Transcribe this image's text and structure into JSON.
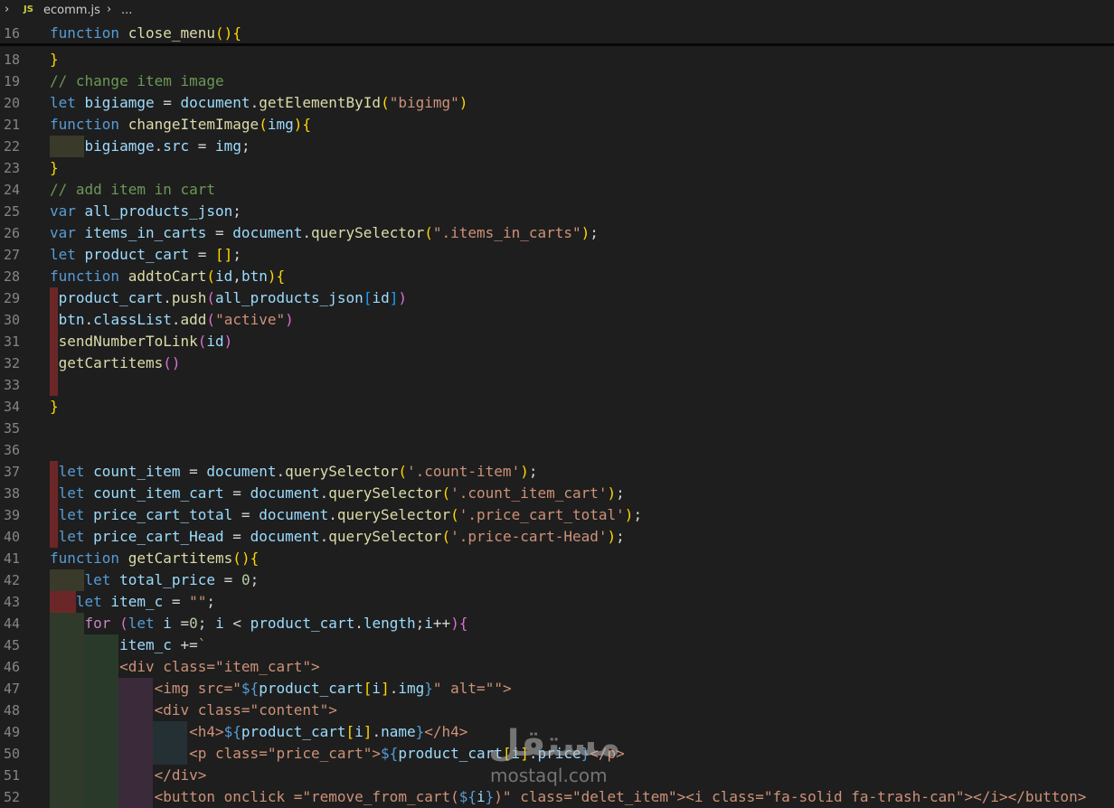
{
  "breadcrumb": {
    "file": "ecomm.js",
    "lang_badge": "JS",
    "trail": "..."
  },
  "sticky": {
    "line_number": "16",
    "tokens": [
      {
        "t": "function",
        "c": "k"
      },
      {
        "t": " close_menu",
        "c": "f"
      },
      {
        "t": "(",
        "c": "y"
      },
      {
        "t": ")",
        "c": "y"
      },
      {
        "t": "{",
        "c": "y"
      }
    ]
  },
  "lines": [
    {
      "n": "18",
      "tokens": [
        {
          "t": "}",
          "c": "y"
        }
      ]
    },
    {
      "n": "19",
      "tokens": [
        {
          "t": "// change item image",
          "c": "c"
        }
      ]
    },
    {
      "n": "20",
      "tokens": [
        {
          "t": "let",
          "c": "k"
        },
        {
          "t": " bigiamge ",
          "c": "v"
        },
        {
          "t": "= ",
          "c": "o"
        },
        {
          "t": "document",
          "c": "v"
        },
        {
          "t": ".",
          "c": "o"
        },
        {
          "t": "getElementById",
          "c": "f"
        },
        {
          "t": "(",
          "c": "y"
        },
        {
          "t": "\"bigimg\"",
          "c": "s"
        },
        {
          "t": ")",
          "c": "y"
        }
      ]
    },
    {
      "n": "21",
      "tokens": [
        {
          "t": "function",
          "c": "k"
        },
        {
          "t": " changeItemImage",
          "c": "f"
        },
        {
          "t": "(",
          "c": "y"
        },
        {
          "t": "img",
          "c": "v"
        },
        {
          "t": ")",
          "c": "y"
        },
        {
          "t": "{",
          "c": "y"
        }
      ]
    },
    {
      "n": "22",
      "tokens": [
        {
          "t": "    bigiamge",
          "c": "v"
        },
        {
          "t": ".",
          "c": "o"
        },
        {
          "t": "src",
          "c": "v"
        },
        {
          "t": " = ",
          "c": "o"
        },
        {
          "t": "img",
          "c": "v"
        },
        {
          "t": ";",
          "c": "o"
        }
      ]
    },
    {
      "n": "23",
      "tokens": [
        {
          "t": "}",
          "c": "y"
        }
      ]
    },
    {
      "n": "24",
      "tokens": [
        {
          "t": "// add item in cart",
          "c": "c"
        }
      ]
    },
    {
      "n": "25",
      "tokens": [
        {
          "t": "var",
          "c": "k"
        },
        {
          "t": " all_products_json",
          "c": "v"
        },
        {
          "t": ";",
          "c": "o"
        }
      ]
    },
    {
      "n": "26",
      "tokens": [
        {
          "t": "var",
          "c": "k"
        },
        {
          "t": " items_in_carts ",
          "c": "v"
        },
        {
          "t": "= ",
          "c": "o"
        },
        {
          "t": "document",
          "c": "v"
        },
        {
          "t": ".",
          "c": "o"
        },
        {
          "t": "querySelector",
          "c": "f"
        },
        {
          "t": "(",
          "c": "y"
        },
        {
          "t": "\".items_in_carts\"",
          "c": "s"
        },
        {
          "t": ")",
          "c": "y"
        },
        {
          "t": ";",
          "c": "o"
        }
      ]
    },
    {
      "n": "27",
      "tokens": [
        {
          "t": "let",
          "c": "k"
        },
        {
          "t": " product_cart ",
          "c": "v"
        },
        {
          "t": "= ",
          "c": "o"
        },
        {
          "t": "[",
          "c": "y"
        },
        {
          "t": "]",
          "c": "y"
        },
        {
          "t": ";",
          "c": "o"
        }
      ]
    },
    {
      "n": "28",
      "tokens": [
        {
          "t": "function",
          "c": "k"
        },
        {
          "t": " addtoCart",
          "c": "f"
        },
        {
          "t": "(",
          "c": "y"
        },
        {
          "t": "id",
          "c": "v"
        },
        {
          "t": ",",
          "c": "o"
        },
        {
          "t": "btn",
          "c": "v"
        },
        {
          "t": ")",
          "c": "y"
        },
        {
          "t": "{",
          "c": "y"
        }
      ]
    },
    {
      "n": "29",
      "tokens": [
        {
          "t": " product_cart",
          "c": "v"
        },
        {
          "t": ".",
          "c": "o"
        },
        {
          "t": "push",
          "c": "f"
        },
        {
          "t": "(",
          "c": "p"
        },
        {
          "t": "all_products_json",
          "c": "v"
        },
        {
          "t": "[",
          "c": "b"
        },
        {
          "t": "id",
          "c": "v"
        },
        {
          "t": "]",
          "c": "b"
        },
        {
          "t": ")",
          "c": "p"
        }
      ]
    },
    {
      "n": "30",
      "tokens": [
        {
          "t": " btn",
          "c": "v"
        },
        {
          "t": ".",
          "c": "o"
        },
        {
          "t": "classList",
          "c": "v"
        },
        {
          "t": ".",
          "c": "o"
        },
        {
          "t": "add",
          "c": "f"
        },
        {
          "t": "(",
          "c": "p"
        },
        {
          "t": "\"active\"",
          "c": "s"
        },
        {
          "t": ")",
          "c": "p"
        }
      ]
    },
    {
      "n": "31",
      "tokens": [
        {
          "t": " sendNumberToLink",
          "c": "f"
        },
        {
          "t": "(",
          "c": "p"
        },
        {
          "t": "id",
          "c": "v"
        },
        {
          "t": ")",
          "c": "p"
        }
      ]
    },
    {
      "n": "32",
      "tokens": [
        {
          "t": " getCartitems",
          "c": "f"
        },
        {
          "t": "(",
          "c": "p"
        },
        {
          "t": ")",
          "c": "p"
        }
      ]
    },
    {
      "n": "33",
      "tokens": []
    },
    {
      "n": "34",
      "tokens": [
        {
          "t": "}",
          "c": "y"
        }
      ]
    },
    {
      "n": "35",
      "tokens": []
    },
    {
      "n": "36",
      "tokens": []
    },
    {
      "n": "37",
      "tokens": [
        {
          "t": " let",
          "c": "k"
        },
        {
          "t": " count_item ",
          "c": "v"
        },
        {
          "t": "= ",
          "c": "o"
        },
        {
          "t": "document",
          "c": "v"
        },
        {
          "t": ".",
          "c": "o"
        },
        {
          "t": "querySelector",
          "c": "f"
        },
        {
          "t": "(",
          "c": "y"
        },
        {
          "t": "'.count-item'",
          "c": "s"
        },
        {
          "t": ")",
          "c": "y"
        },
        {
          "t": ";",
          "c": "o"
        }
      ]
    },
    {
      "n": "38",
      "tokens": [
        {
          "t": " let",
          "c": "k"
        },
        {
          "t": " count_item_cart ",
          "c": "v"
        },
        {
          "t": "= ",
          "c": "o"
        },
        {
          "t": "document",
          "c": "v"
        },
        {
          "t": ".",
          "c": "o"
        },
        {
          "t": "querySelector",
          "c": "f"
        },
        {
          "t": "(",
          "c": "y"
        },
        {
          "t": "'.count_item_cart'",
          "c": "s"
        },
        {
          "t": ")",
          "c": "y"
        },
        {
          "t": ";",
          "c": "o"
        }
      ]
    },
    {
      "n": "39",
      "tokens": [
        {
          "t": " let",
          "c": "k"
        },
        {
          "t": " price_cart_total ",
          "c": "v"
        },
        {
          "t": "= ",
          "c": "o"
        },
        {
          "t": "document",
          "c": "v"
        },
        {
          "t": ".",
          "c": "o"
        },
        {
          "t": "querySelector",
          "c": "f"
        },
        {
          "t": "(",
          "c": "y"
        },
        {
          "t": "'.price_cart_total'",
          "c": "s"
        },
        {
          "t": ")",
          "c": "y"
        },
        {
          "t": ";",
          "c": "o"
        }
      ]
    },
    {
      "n": "40",
      "tokens": [
        {
          "t": " let",
          "c": "k"
        },
        {
          "t": " price_cart_Head ",
          "c": "v"
        },
        {
          "t": "= ",
          "c": "o"
        },
        {
          "t": "document",
          "c": "v"
        },
        {
          "t": ".",
          "c": "o"
        },
        {
          "t": "querySelector",
          "c": "f"
        },
        {
          "t": "(",
          "c": "y"
        },
        {
          "t": "'.price-cart-Head'",
          "c": "s"
        },
        {
          "t": ")",
          "c": "y"
        },
        {
          "t": ";",
          "c": "o"
        }
      ]
    },
    {
      "n": "41",
      "tokens": [
        {
          "t": "function",
          "c": "k"
        },
        {
          "t": " getCartitems",
          "c": "f"
        },
        {
          "t": "(",
          "c": "y"
        },
        {
          "t": ")",
          "c": "y"
        },
        {
          "t": "{",
          "c": "y"
        }
      ]
    },
    {
      "n": "42",
      "tokens": [
        {
          "t": "    let",
          "c": "k"
        },
        {
          "t": " total_price ",
          "c": "v"
        },
        {
          "t": "= ",
          "c": "o"
        },
        {
          "t": "0",
          "c": "n"
        },
        {
          "t": ";",
          "c": "o"
        }
      ]
    },
    {
      "n": "43",
      "tokens": [
        {
          "t": "   let",
          "c": "k"
        },
        {
          "t": " item_c ",
          "c": "v"
        },
        {
          "t": "= ",
          "c": "o"
        },
        {
          "t": "\"\"",
          "c": "s"
        },
        {
          "t": ";",
          "c": "o"
        }
      ]
    },
    {
      "n": "44",
      "tokens": [
        {
          "t": "    for",
          "c": "kw"
        },
        {
          "t": " (",
          "c": "p"
        },
        {
          "t": "let",
          "c": "k"
        },
        {
          "t": " i ",
          "c": "v"
        },
        {
          "t": "=",
          "c": "o"
        },
        {
          "t": "0",
          "c": "n"
        },
        {
          "t": "; ",
          "c": "o"
        },
        {
          "t": "i",
          "c": "v"
        },
        {
          "t": " < ",
          "c": "o"
        },
        {
          "t": "product_cart",
          "c": "v"
        },
        {
          "t": ".",
          "c": "o"
        },
        {
          "t": "length",
          "c": "v"
        },
        {
          "t": ";",
          "c": "o"
        },
        {
          "t": "i",
          "c": "v"
        },
        {
          "t": "++",
          "c": "o"
        },
        {
          "t": ")",
          "c": "p"
        },
        {
          "t": "{",
          "c": "p"
        }
      ]
    },
    {
      "n": "45",
      "tokens": [
        {
          "t": "        item_c ",
          "c": "v"
        },
        {
          "t": "+=",
          "c": "o"
        },
        {
          "t": "`",
          "c": "s"
        }
      ]
    },
    {
      "n": "46",
      "tokens": [
        {
          "t": "        <div class=\"item_cart\">",
          "c": "s"
        }
      ]
    },
    {
      "n": "47",
      "tokens": [
        {
          "t": "            <img src=\"",
          "c": "s"
        },
        {
          "t": "${",
          "c": "k"
        },
        {
          "t": "product_cart",
          "c": "v"
        },
        {
          "t": "[",
          "c": "y"
        },
        {
          "t": "i",
          "c": "v"
        },
        {
          "t": "]",
          "c": "y"
        },
        {
          "t": ".",
          "c": "o"
        },
        {
          "t": "img",
          "c": "v"
        },
        {
          "t": "}",
          "c": "k"
        },
        {
          "t": "\" alt=\"\">",
          "c": "s"
        }
      ]
    },
    {
      "n": "48",
      "tokens": [
        {
          "t": "            <div class=\"content\">",
          "c": "s"
        }
      ]
    },
    {
      "n": "49",
      "tokens": [
        {
          "t": "                <h4>",
          "c": "s"
        },
        {
          "t": "${",
          "c": "k"
        },
        {
          "t": "product_cart",
          "c": "v"
        },
        {
          "t": "[",
          "c": "y"
        },
        {
          "t": "i",
          "c": "v"
        },
        {
          "t": "]",
          "c": "y"
        },
        {
          "t": ".",
          "c": "o"
        },
        {
          "t": "name",
          "c": "v"
        },
        {
          "t": "}",
          "c": "k"
        },
        {
          "t": "</h4>",
          "c": "s"
        }
      ]
    },
    {
      "n": "50",
      "tokens": [
        {
          "t": "                <p class=\"price_cart\">",
          "c": "s"
        },
        {
          "t": "${",
          "c": "k"
        },
        {
          "t": "product_cart",
          "c": "v"
        },
        {
          "t": "[",
          "c": "y"
        },
        {
          "t": "i",
          "c": "v"
        },
        {
          "t": "]",
          "c": "y"
        },
        {
          "t": ".",
          "c": "o"
        },
        {
          "t": "price",
          "c": "v"
        },
        {
          "t": "}",
          "c": "k"
        },
        {
          "t": "</p>",
          "c": "s"
        }
      ]
    },
    {
      "n": "51",
      "tokens": [
        {
          "t": "            </div>",
          "c": "s"
        }
      ]
    },
    {
      "n": "52",
      "tokens": [
        {
          "t": "            <button onclick =\"remove_from_cart(",
          "c": "s"
        },
        {
          "t": "${",
          "c": "k"
        },
        {
          "t": "i",
          "c": "v"
        },
        {
          "t": "}",
          "c": "k"
        },
        {
          "t": ")\" class=\"delet_item\"><i class=\"fa-solid fa-trash-can\"></i></button>",
          "c": "s"
        }
      ]
    }
  ],
  "watermark": {
    "arabic": "مستقل",
    "latin": "mostaql.com"
  }
}
